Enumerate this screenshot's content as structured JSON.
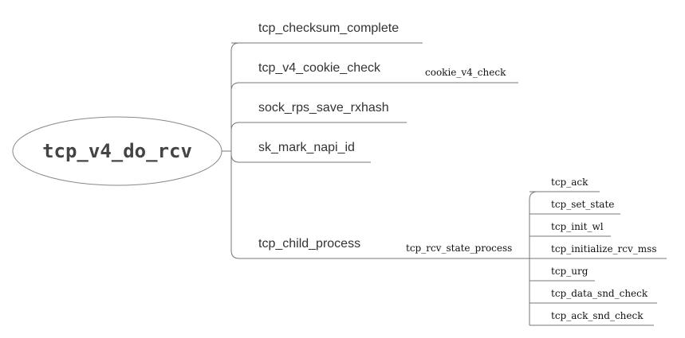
{
  "root": {
    "label": "tcp_v4_do_rcv"
  },
  "branches": [
    {
      "label": "tcp_checksum_complete"
    },
    {
      "label": "tcp_v4_cookie_check",
      "child": "cookie_v4_check"
    },
    {
      "label": "sock_rps_save_rxhash"
    },
    {
      "label": "sk_mark_napi_id"
    },
    {
      "label": "tcp_child_process",
      "child": "tcp_rcv_state_process",
      "grandchildren": [
        "tcp_ack",
        "tcp_set_state",
        "tcp_init_wl",
        "tcp_initialize_rcv_mss",
        "tcp_urg",
        "tcp_data_snd_check",
        "tcp_ack_snd_check"
      ]
    }
  ]
}
